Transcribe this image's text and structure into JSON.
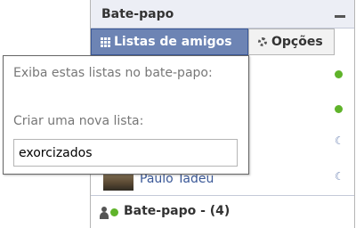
{
  "chat": {
    "title": "Bate-papo",
    "tabs": {
      "friend_lists": "Listas de amigos",
      "options": "Opções"
    },
    "friends": [
      {
        "name": "Paulo Tadeu",
        "status": "idle"
      }
    ],
    "status_markers": [
      "online",
      "online",
      "idle",
      "idle"
    ],
    "footer_label": "Bate-papo - (4)"
  },
  "popover": {
    "description": "Exiba estas listas no bate-papo:",
    "create_label": "Criar uma nova lista:",
    "input_value": "exorcizados"
  },
  "colors": {
    "accent": "#6d84b4",
    "online": "#5fb32a",
    "link": "#3b5998"
  }
}
